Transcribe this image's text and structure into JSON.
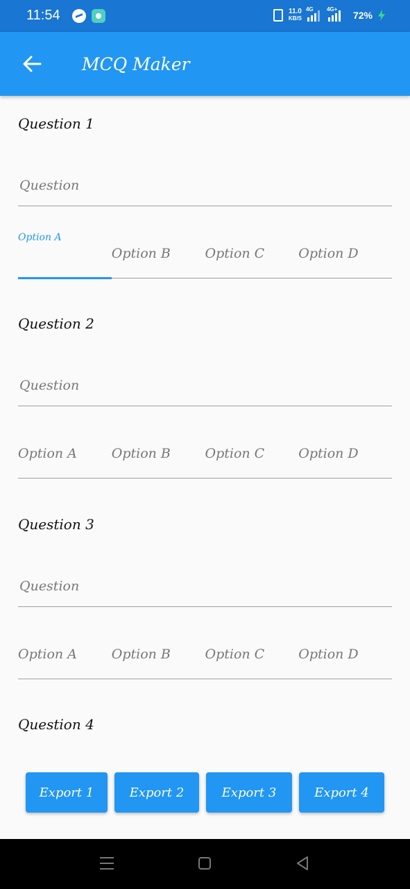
{
  "status_bar": {
    "time": "11:54",
    "net_speed_value": "11.0",
    "net_speed_unit": "KB/S",
    "signal1_label": "4G",
    "signal2_label": "4G+",
    "battery": "72%"
  },
  "app_bar": {
    "title": "MCQ Maker"
  },
  "questions": [
    {
      "label": "Question 1",
      "placeholder": "Question",
      "options": [
        "Option A",
        "Option B",
        "Option C",
        "Option D"
      ]
    },
    {
      "label": "Question 2",
      "placeholder": "Question",
      "options": [
        "Option A",
        "Option B",
        "Option C",
        "Option D"
      ]
    },
    {
      "label": "Question 3",
      "placeholder": "Question",
      "options": [
        "Option A",
        "Option B",
        "Option C",
        "Option D"
      ]
    },
    {
      "label": "Question 4"
    }
  ],
  "focused_field": "Question 1 / Option A",
  "export_buttons": [
    "Export 1",
    "Export 2",
    "Export 3",
    "Export 4"
  ],
  "colors": {
    "primary": "#2196f3",
    "status_bar": "#1976d2",
    "divider": "#9e9e9e",
    "background": "#fafafa"
  },
  "icons": [
    "back-arrow-icon",
    "messenger-icon",
    "chat-app-icon",
    "vibrate-icon",
    "signal-icon",
    "battery-charging-icon",
    "nav-menu-icon",
    "nav-home-icon",
    "nav-back-icon"
  ]
}
